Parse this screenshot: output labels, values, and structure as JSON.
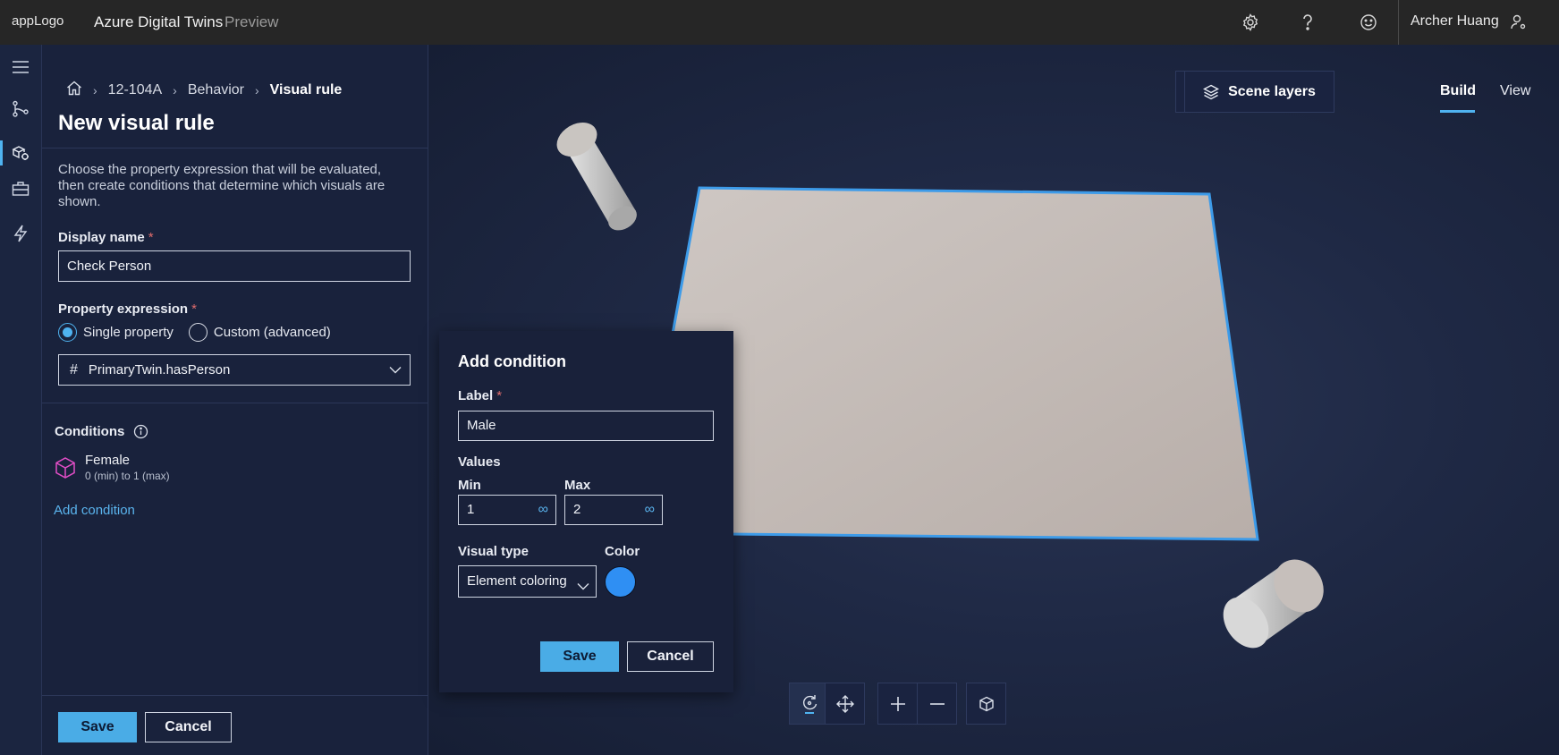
{
  "topbar": {
    "logo_alt": "appLogo",
    "app_title": "Azure Digital Twins",
    "app_badge": "Preview",
    "user_name": "Archer Huang",
    "icons": [
      "gear-icon",
      "help-icon",
      "feedback-smiley-icon",
      "person-settings-icon"
    ]
  },
  "rail": {
    "items": [
      "menu-icon",
      "twin-graph-icon",
      "scene-builder-icon",
      "toolbox-icon",
      "events-icon"
    ],
    "active_index": 2
  },
  "panel": {
    "breadcrumb": {
      "home_icon": "home-icon",
      "items": [
        "12-104A",
        "Behavior",
        "Visual rule"
      ]
    },
    "title": "New visual rule",
    "description": "Choose the property expression that will be evaluated, then create conditions that determine which visuals are shown.",
    "display_name_label": "Display name",
    "display_name_value": "Check Person",
    "property_expression_label": "Property expression",
    "radio_single": "Single property",
    "radio_custom": "Custom (advanced)",
    "selected_mode": "Single property",
    "property_value": "PrimaryTwin.hasPerson",
    "property_prefix": "#",
    "conditions_label": "Conditions",
    "conditions": [
      {
        "name": "Female",
        "range": "0 (min) to 1 (max)",
        "icon": "cube-icon",
        "color": "#e24ec7"
      }
    ],
    "add_condition": "Add condition",
    "save": "Save",
    "cancel": "Cancel"
  },
  "scene": {
    "toolbar_icons": [
      "object-coloring-icon",
      "theme-palette-icon"
    ],
    "scene_layers": "Scene layers",
    "modes": [
      "Build",
      "View"
    ],
    "active_mode": "Build",
    "bottom_tools": [
      "orbit-icon",
      "pan-icon",
      "zoom-in-icon",
      "zoom-out-icon",
      "reset-camera-icon"
    ],
    "active_tool": "orbit-icon"
  },
  "popup": {
    "title": "Add condition",
    "label_label": "Label",
    "label_value": "Male",
    "values_label": "Values",
    "min_label": "Min",
    "min_value": "1",
    "max_label": "Max",
    "max_value": "2",
    "infinity_symbol": "∞",
    "visual_type_label": "Visual type",
    "visual_type_value": "Element coloring",
    "color_label": "Color",
    "color_value": "#2f8ff3",
    "save": "Save",
    "cancel": "Cancel"
  },
  "colors": {
    "accent": "#4fb3f0",
    "primary_button": "#4aace6",
    "selection_outline": "#3d9be9"
  }
}
